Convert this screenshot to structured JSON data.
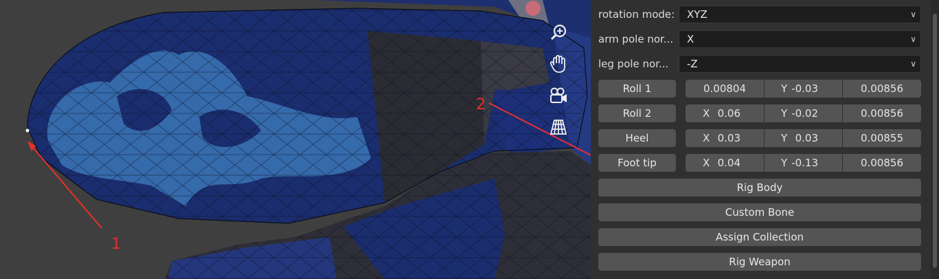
{
  "viewport": {
    "tools": [
      {
        "name": "zoom-icon"
      },
      {
        "name": "hand-pan-icon"
      },
      {
        "name": "camera-icon"
      },
      {
        "name": "perspective-grid-icon"
      }
    ],
    "annotations": [
      {
        "label": "1"
      },
      {
        "label": "2"
      }
    ],
    "colors": {
      "annotation": "#e8302a",
      "mesh_dark": "#1a2d6e",
      "mesh_light": "#3f7fc0",
      "mesh_grey": "#2e2e36"
    }
  },
  "panel": {
    "rotation_mode": {
      "label": "rotation mode:",
      "value": "XYZ"
    },
    "arm_pole": {
      "label": "arm pole nor...",
      "value": "X"
    },
    "leg_pole": {
      "label": "leg pole nor...",
      "value": "-Z"
    },
    "bones": [
      {
        "label": "Roll 1",
        "x_axis": "",
        "x": "0.00804",
        "y_axis": "Y",
        "y": "-0.03",
        "z": "0.00856"
      },
      {
        "label": "Roll 2",
        "x_axis": "X",
        "x": "0.06",
        "y_axis": "Y",
        "y": "-0.02",
        "z": "0.00856"
      },
      {
        "label": "Heel",
        "x_axis": "X",
        "x": "0.03",
        "y_axis": "Y",
        "y": "0.03",
        "z": "0.00855"
      },
      {
        "label": "Foot tip",
        "x_axis": "X",
        "x": "0.04",
        "y_axis": "Y",
        "y": "-0.13",
        "z": "0.00856"
      }
    ],
    "actions": {
      "rig_body": "Rig Body",
      "custom_bone": "Custom Bone",
      "assign_collection": "Assign Collection",
      "rig_weapon": "Rig Weapon"
    }
  }
}
